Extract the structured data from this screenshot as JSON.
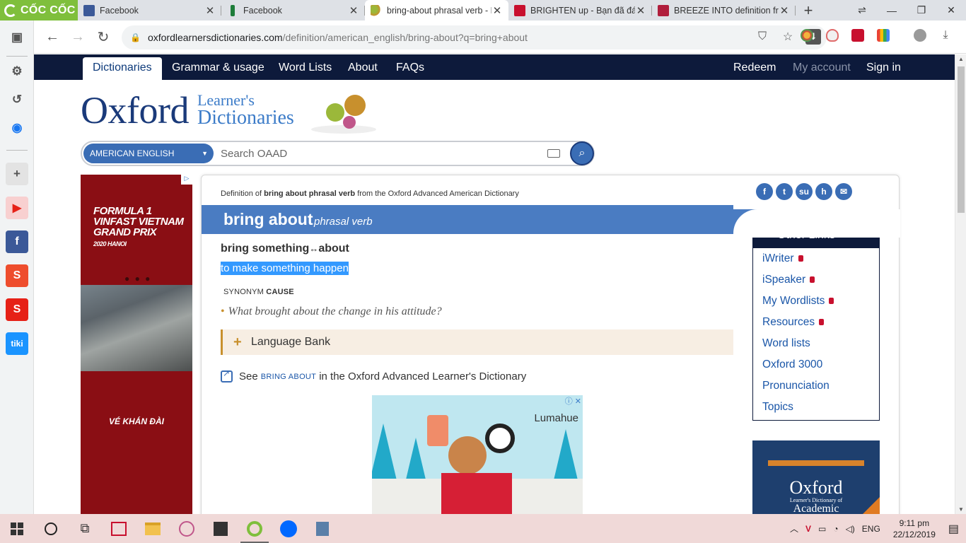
{
  "browser": {
    "brand": "CỐC CỐC",
    "tabs": [
      {
        "title": "Facebook",
        "color": "#3b5998"
      },
      {
        "title": "Facebook",
        "color": "#1e7d3a"
      },
      {
        "title": "bring-about phrasal verb - D",
        "color": "#c8902d",
        "active": true
      },
      {
        "title": "BRIGHTEN up - Bạn đã đánh",
        "color": "#c8102e"
      },
      {
        "title": "BREEZE INTO definition from",
        "color": "#b01e3c"
      }
    ],
    "url_host": "oxfordlearnersdictionaries.com",
    "url_path": "/definition/american_english/bring-about?q=bring+about"
  },
  "site": {
    "nav": [
      "Dictionaries",
      "Grammar & usage",
      "Word Lists",
      "About",
      "FAQs"
    ],
    "nav_right": [
      "Redeem",
      "My account",
      "Sign in"
    ],
    "logo_main": "Oxford",
    "logo_line1": "Learner's",
    "logo_line2": "Dictionaries",
    "dictionary_select": "AMERICAN ENGLISH",
    "search_placeholder": "Search OAAD"
  },
  "entry": {
    "source_prefix": "Definition of",
    "source_term": "bring about phrasal verb",
    "source_suffix": "from the Oxford Advanced American Dictionary",
    "headword": "bring about",
    "pos": "phrasal verb",
    "phrase_a": "bring something",
    "phrase_arrow": "↔",
    "phrase_b": "about",
    "definition": "to make something happen",
    "synonym_label": "SYNONYM",
    "synonym": "CAUSE",
    "example": "What brought about the change in his attitude?",
    "language_bank": "Language Bank",
    "see_prefix": "See",
    "see_term": "BRING ABOUT",
    "see_suffix": "in the Oxford Advanced Learner's Dictionary"
  },
  "other_links": {
    "title": "Other Links",
    "items": [
      {
        "label": "iWriter",
        "locked": true
      },
      {
        "label": "iSpeaker",
        "locked": true
      },
      {
        "label": "My Wordlists",
        "locked": true
      },
      {
        "label": "Resources",
        "locked": true
      },
      {
        "label": "Word lists",
        "locked": false
      },
      {
        "label": "Oxford 3000",
        "locked": false
      },
      {
        "label": "Pronunciation",
        "locked": false
      },
      {
        "label": "Topics",
        "locked": false
      }
    ]
  },
  "ads": {
    "left_title": "FORMULA 1",
    "left_sub": "VINFAST VIETNAM GRAND PRIX",
    "left_year": "2020 HANOI",
    "left_cta": "VÉ KHÁN ĐÀI",
    "mid_brand": "Lumahue",
    "right_title": "Oxford",
    "right_sub": "Learner's Dictionary of",
    "right_title2": "Academic"
  },
  "taskbar": {
    "lang": "ENG",
    "time": "9:11 pm",
    "date": "22/12/2019"
  }
}
